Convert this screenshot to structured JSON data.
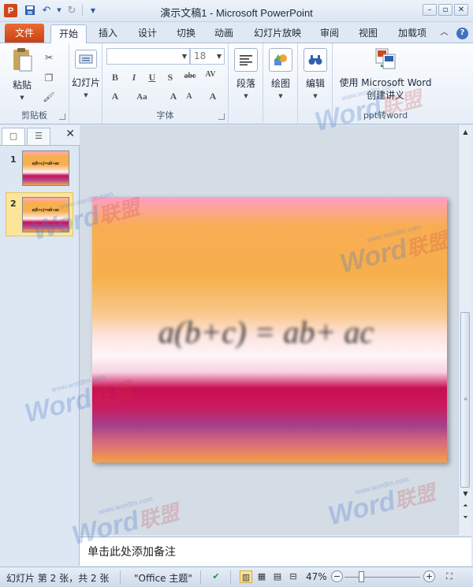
{
  "titlebar": {
    "app_logo": "P",
    "title": "演示文稿1 - Microsoft PowerPoint",
    "qat": [
      "save-icon",
      "undo-icon",
      "redo-icon",
      "customize-qat-icon"
    ],
    "window_controls": [
      "minimize-icon",
      "restore-icon",
      "close-icon"
    ]
  },
  "tabs": {
    "file": "文件",
    "items": [
      "开始",
      "插入",
      "设计",
      "切换",
      "动画",
      "幻灯片放映",
      "审阅",
      "视图",
      "加载项"
    ],
    "active": "开始"
  },
  "ribbon": {
    "clipboard": {
      "paste": "粘贴",
      "label": "剪贴板"
    },
    "slides": {
      "new_slide": "幻灯片"
    },
    "font": {
      "font_name": "",
      "font_size": "18",
      "label": "字体"
    },
    "paragraph": {
      "button": "段落"
    },
    "drawing": {
      "button": "绘图"
    },
    "editing": {
      "button": "编辑"
    },
    "handout": {
      "button_line1": "使用 Microsoft Word",
      "button_line2": "创建讲义",
      "label": "ppt转word"
    }
  },
  "pane": {
    "thumbnails": [
      {
        "number": "1",
        "formula": "a(b+c)=ab+ac"
      },
      {
        "number": "2",
        "formula": "a(b+c)=ab+ac"
      }
    ],
    "selected": "2"
  },
  "slide": {
    "formula": "a(b+c) = ab+ ac"
  },
  "notes": {
    "placeholder": "单击此处添加备注"
  },
  "statusbar": {
    "slide_info": "幻灯片 第 2 张，共 2 张",
    "theme": "\"Office 主题\"",
    "zoom": "47%"
  },
  "watermark": {
    "brand": "Word",
    "cn": "联盟",
    "url": "www.wordlm.com"
  }
}
